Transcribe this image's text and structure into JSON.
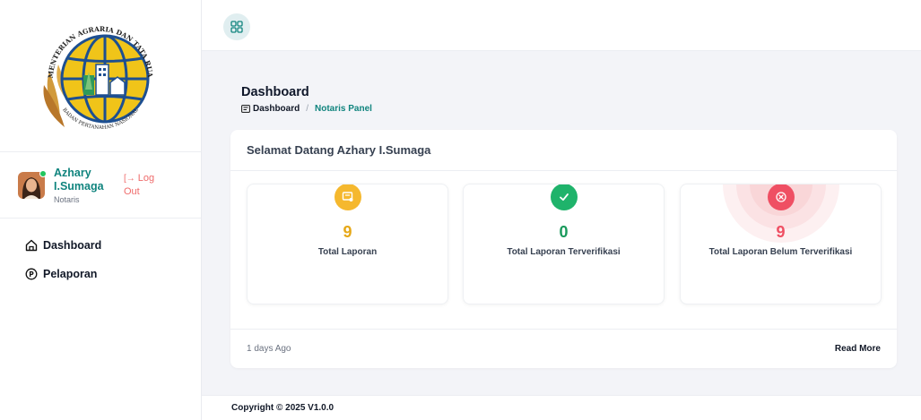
{
  "logo": {
    "text_top": "KEMENTERIAN AGRARIA DAN TATA RUANG",
    "text_bottom": "BADAN PERTANAHAN NASIONAL"
  },
  "profile": {
    "name": "Azhary I.Sumaga",
    "role": "Notaris",
    "logout_label": "Log Out"
  },
  "menu": [
    {
      "label": "Dashboard",
      "icon": "home-icon"
    },
    {
      "label": "Pelaporan",
      "icon": "p-circle-icon"
    }
  ],
  "page": {
    "title": "Dashboard",
    "breadcrumb": [
      "Dashboard",
      "Notaris Panel"
    ]
  },
  "card": {
    "header": "Selamat Datang Azhary I.Sumaga",
    "stats": [
      {
        "value": "9",
        "label": "Total Laporan",
        "color": "#f5b82e",
        "icon": "report-icon"
      },
      {
        "value": "0",
        "label": "Total Laporan Terverifikasi",
        "color": "#1fb36b",
        "icon": "check-icon"
      },
      {
        "value": "9",
        "label": "Total Laporan Belum Terverifikasi",
        "color": "#f0506e",
        "icon": "x-circle-icon"
      }
    ],
    "footer_left": "1 days Ago",
    "footer_right": "Read More"
  },
  "footer": {
    "copyright": "Copyright © 2025 V1.0.0"
  },
  "colors": {
    "accent": "#10847e",
    "danger": "#f0506e",
    "warning": "#f5b82e",
    "success": "#1fb36b"
  }
}
